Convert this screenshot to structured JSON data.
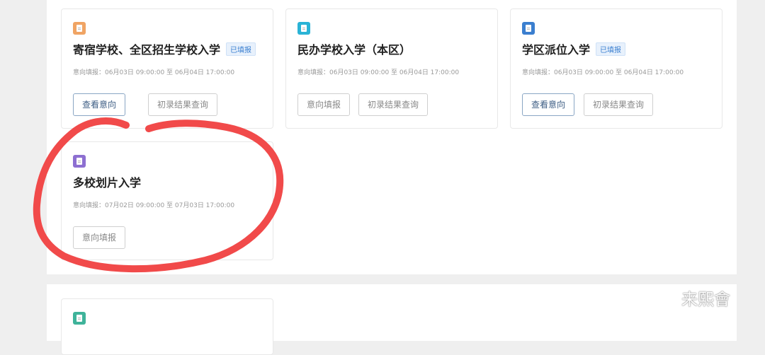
{
  "cards": [
    {
      "title": "寄宿学校、全区招生学校入学",
      "badge": "已填报",
      "time": "意向填报：06月03日 09:00:00 至 06月04日 17:00:00",
      "btn1": "查看意向",
      "btn2": "初录结果查询",
      "icon": "document-icon",
      "color": "#f0a464"
    },
    {
      "title": "民办学校入学（本区）",
      "badge": "",
      "time": "意向填报：06月03日 09:00:00 至 06月04日 17:00:00",
      "btn1": "意向填报",
      "btn2": "初录结果查询",
      "icon": "document-icon",
      "color": "#2ab3d6"
    },
    {
      "title": "学区派位入学",
      "badge": "已填报",
      "time": "意向填报：06月03日 09:00:00 至 06月04日 17:00:00",
      "btn1": "查看意向",
      "btn2": "初录结果查询",
      "icon": "document-icon",
      "color": "#3b7fcf"
    },
    {
      "title": "多校划片入学",
      "badge": "",
      "time": "意向填报：07月02日 09:00:00 至 07月03日 17:00:00",
      "btn1": "意向填报",
      "icon": "document-icon",
      "color": "#8d6fd1"
    },
    {
      "icon": "document-icon",
      "color": "#3fb39a"
    }
  ],
  "watermark": "来熙會"
}
